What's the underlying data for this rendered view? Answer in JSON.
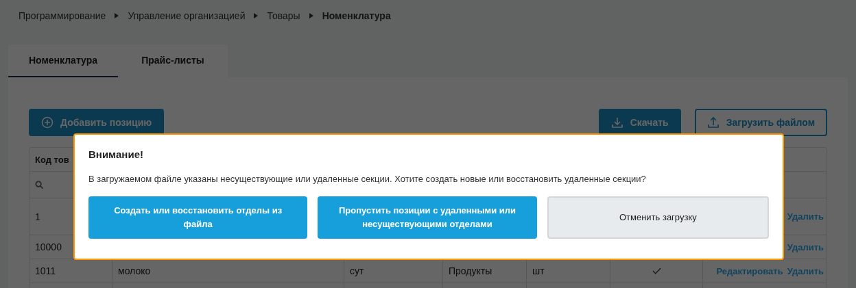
{
  "breadcrumbs": [
    {
      "label": "Программирование",
      "current": false
    },
    {
      "label": "Управление организацией",
      "current": false
    },
    {
      "label": "Товары",
      "current": false
    },
    {
      "label": "Номенклатура",
      "current": true
    }
  ],
  "tabs": [
    {
      "label": "Номенклатура",
      "selected": true
    },
    {
      "label": "Прайс-листы",
      "selected": false
    }
  ],
  "toolbar": {
    "add_button": "Добавить позицию",
    "download_button": "Скачать",
    "upload_button": "Загрузить файлом"
  },
  "table": {
    "columns": [
      "Код тов"
    ],
    "rows": [
      {
        "code": "1",
        "actions": [
          "Удалить"
        ]
      },
      {
        "code": "10000",
        "actions": [
          "Удалить"
        ]
      },
      {
        "code": "1011",
        "name": "молоко",
        "column_3": "сут",
        "section": "Продукты",
        "unit": "шт",
        "checked": true,
        "actions": [
          "Редактировать",
          "Удалить"
        ]
      }
    ]
  },
  "dialog": {
    "title": "Внимание!",
    "message": "В загружаемом файле указаны несуществующие или удаленные секции. Хотите создать новые или восстановить удаленные секции?",
    "buttons": [
      {
        "label": "Создать или восстановить отделы из файла",
        "kind": "primary"
      },
      {
        "label": "Пропустить позиции с удаленными или несуществующими отделами",
        "kind": "primary"
      },
      {
        "label": "Отменить загрузку",
        "kind": "secondary"
      }
    ]
  }
}
